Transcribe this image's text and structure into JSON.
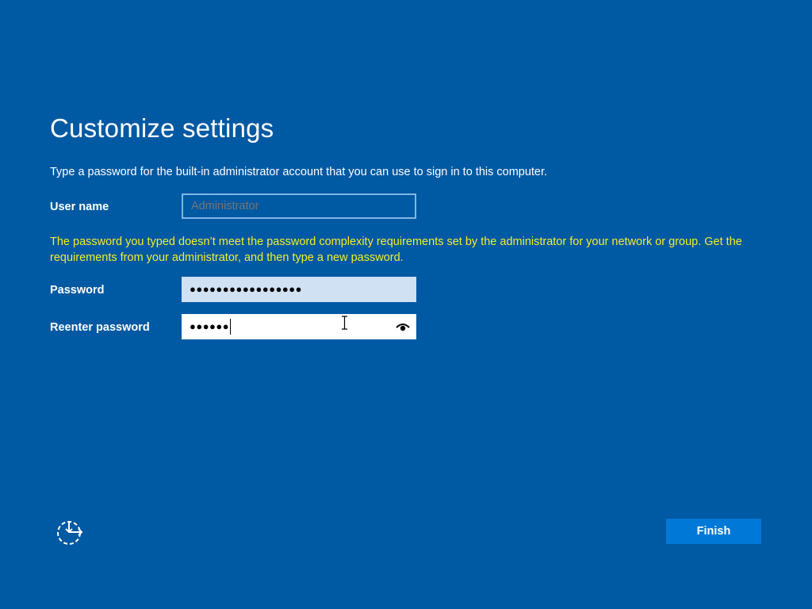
{
  "page": {
    "title": "Customize settings",
    "instructions": "Type a password for the built-in administrator account that you can use to sign in to this computer."
  },
  "form": {
    "username": {
      "label": "User name",
      "placeholder": "Administrator",
      "value": ""
    },
    "error_message": "The password you typed doesn’t meet the password complexity requirements set by the administrator for your network or group. Get the requirements from your administrator, and then type a new password.",
    "password": {
      "label": "Password",
      "masked_value": "●●●●●●●●●●●●●●●●●"
    },
    "reenter_password": {
      "label": "Reenter password",
      "masked_value": "●●●●●●"
    }
  },
  "footer": {
    "accessibility_icon": "ease-of-access-icon",
    "finish_label": "Finish"
  },
  "colors": {
    "background": "#0059a3",
    "error": "#f2ee2c",
    "button": "#0078d7"
  }
}
